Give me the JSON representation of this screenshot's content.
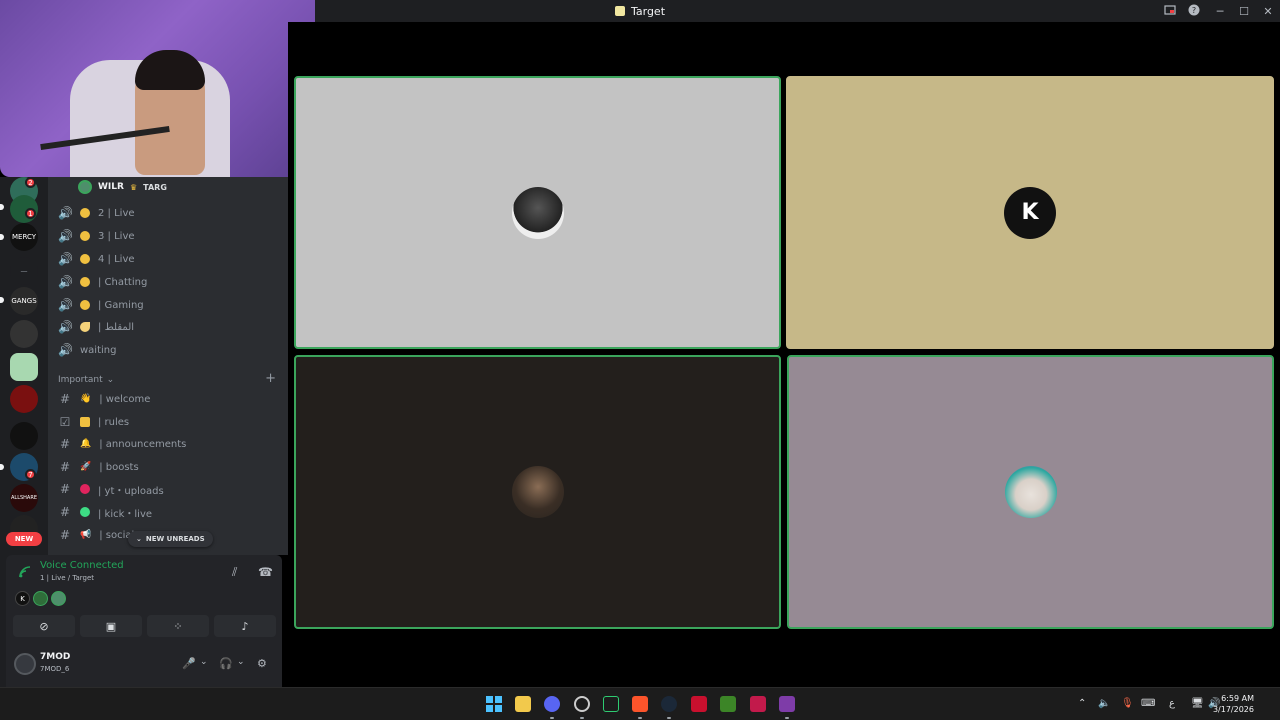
{
  "window": {
    "title": "Target"
  },
  "member": {
    "name": "WILR",
    "tag": "TARG"
  },
  "voice_channels": [
    {
      "label": "2 | Live"
    },
    {
      "label": "3 | Live"
    },
    {
      "label": "4 | Live"
    },
    {
      "label": "| Chatting"
    },
    {
      "label": "| Gaming"
    },
    {
      "label": "| المقلط"
    },
    {
      "label": "waiting"
    }
  ],
  "category": {
    "label": "Important"
  },
  "text_channels": [
    {
      "label": "| welcome"
    },
    {
      "label": "| rules"
    },
    {
      "label": "| announcements"
    },
    {
      "label": "| boosts"
    },
    {
      "label": "| yt・uploads"
    },
    {
      "label": "| kick・live"
    },
    {
      "label": "| social"
    }
  ],
  "new_unreads": "NEW UNREADS",
  "rail": {
    "new_label": "NEW",
    "badges": [
      "2",
      "1",
      "7"
    ],
    "server_labels": [
      "MERCY",
      "GANGS",
      "ALLSHARE"
    ]
  },
  "voice_panel": {
    "status": "Voice Connected",
    "channel": "1 | Live / Target"
  },
  "user": {
    "name": "7MOD",
    "status": "7MOD_6"
  },
  "taskbar": {
    "time": "6:59 AM",
    "date": "3/17/2026",
    "lang": "ع"
  },
  "colors": {
    "accent_green": "#23a55a",
    "speaking_border": "#3ba55c",
    "danger": "#f23f43"
  }
}
